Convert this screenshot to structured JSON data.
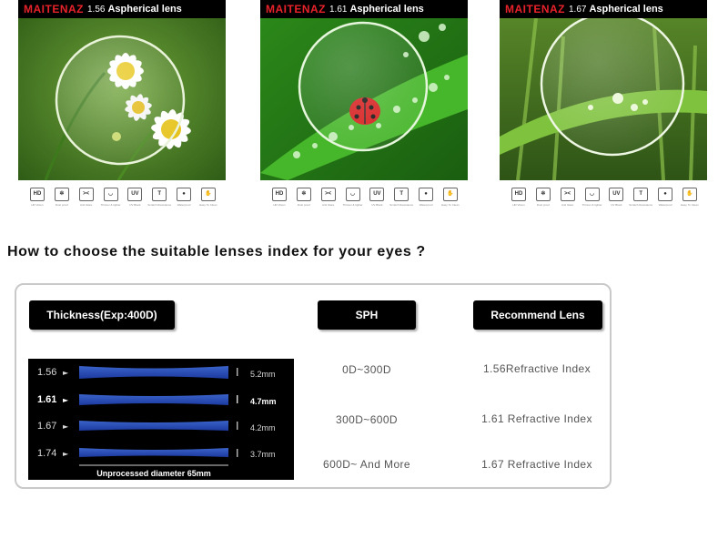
{
  "products": [
    {
      "brand": "MAITENAZ",
      "index": "1.56",
      "label": "Aspherical lens"
    },
    {
      "brand": "MAITENAZ",
      "index": "1.61",
      "label": "Aspherical lens"
    },
    {
      "brand": "MAITENAZ",
      "index": "1.67",
      "label": "Aspherical lens"
    }
  ],
  "feature_icons": [
    {
      "icon": "hd-icon",
      "symbol": "HD",
      "label": "HD Vision"
    },
    {
      "icon": "sun-icon",
      "symbol": "✲",
      "label": "Dust proof"
    },
    {
      "icon": "anti-glare-icon",
      "symbol": "><",
      "label": "Anti Glare"
    },
    {
      "icon": "thin-lens-icon",
      "symbol": "◡",
      "label": "Thinner & lighter"
    },
    {
      "icon": "uv-icon",
      "symbol": "UV",
      "label": "UV Block"
    },
    {
      "icon": "scratch-icon",
      "symbol": "T",
      "label": "Scratch Resistance"
    },
    {
      "icon": "water-drop-icon",
      "symbol": "●",
      "label": "Waterproof"
    },
    {
      "icon": "hand-icon",
      "symbol": "✋",
      "label": "Easy To Clean"
    }
  ],
  "heading": "How to choose the suitable lenses index for your eyes ?",
  "table": {
    "headers": [
      "Thickness(Exp:400D)",
      "SPH",
      "Recommend Lens"
    ],
    "rows": [
      {
        "sph": "0D~300D",
        "lens": "1.56Refractive Index"
      },
      {
        "sph": "300D~600D",
        "lens": "1.61 Refractive Index"
      },
      {
        "sph": "600D~ And More",
        "lens": "1.67 Refractive Index"
      }
    ]
  },
  "thickness_diagram": {
    "rows": [
      {
        "index": "1.56",
        "thickness": "5.2mm",
        "highlight": false
      },
      {
        "index": "1.61",
        "thickness": "4.7mm",
        "highlight": true
      },
      {
        "index": "1.67",
        "thickness": "4.2mm",
        "highlight": false
      },
      {
        "index": "1.74",
        "thickness": "3.7mm",
        "highlight": false
      }
    ],
    "caption": "Unprocessed diameter 65mm"
  }
}
